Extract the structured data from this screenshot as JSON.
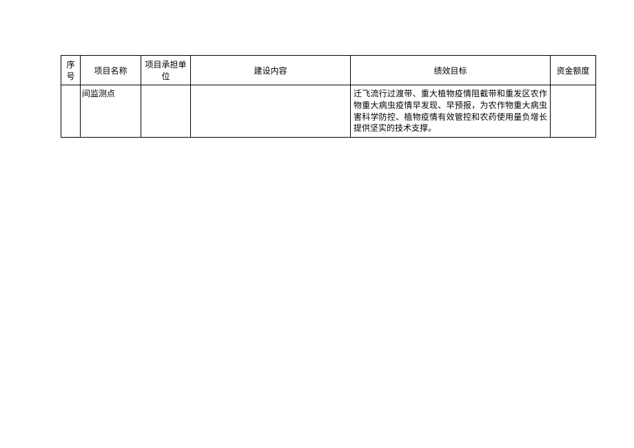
{
  "table": {
    "headers": {
      "seq": "序号",
      "name": "项目名称",
      "unit": "项目承担单位",
      "content": "建设内容",
      "goal": "绩效目标",
      "amount": "资金额度"
    },
    "rows": [
      {
        "seq": "",
        "name": "间监测点",
        "unit": "",
        "content": "",
        "goal": "迁飞流行过渡带、重大植物疫情阻截带和重发区农作物重大病虫疫情早发现、早预报，为农作物重大病虫害科学防控、植物疫情有效管控和农药使用量负增长提供坚实的技术支撑。",
        "amount": ""
      }
    ]
  }
}
